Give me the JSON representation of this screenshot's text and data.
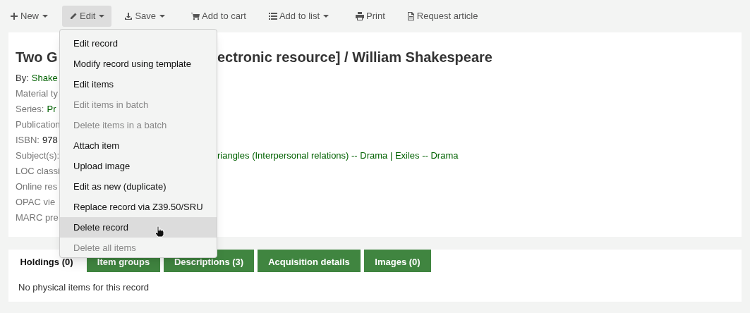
{
  "toolbar": [
    {
      "label": "New",
      "caret": true,
      "active": false
    },
    {
      "label": "Edit",
      "caret": true,
      "active": true
    },
    {
      "label": "Save",
      "caret": true,
      "active": false
    },
    {
      "label": "Add to cart",
      "caret": false,
      "active": false
    },
    {
      "label": "Add to list",
      "caret": true,
      "active": false
    },
    {
      "label": "Print",
      "caret": false,
      "active": false
    },
    {
      "label": "Request article",
      "caret": false,
      "active": false
    }
  ],
  "edit_menu": [
    {
      "label": "Edit record",
      "disabled": false,
      "highlighted": false
    },
    {
      "label": "Modify record using template",
      "disabled": false,
      "highlighted": false
    },
    {
      "label": "Edit items",
      "disabled": false,
      "highlighted": false
    },
    {
      "label": "Edit items in batch",
      "disabled": true,
      "highlighted": false
    },
    {
      "label": "Delete items in a batch",
      "disabled": true,
      "highlighted": false
    },
    {
      "label": "Attach item",
      "disabled": false,
      "highlighted": false
    },
    {
      "label": "Upload image",
      "disabled": false,
      "highlighted": false
    },
    {
      "label": "Edit as new (duplicate)",
      "disabled": false,
      "highlighted": false
    },
    {
      "label": "Replace record via Z39.50/SRU",
      "disabled": false,
      "highlighted": false
    },
    {
      "label": "Delete record",
      "disabled": false,
      "highlighted": true
    },
    {
      "label": "Delete all items",
      "disabled": true,
      "highlighted": false
    }
  ],
  "record": {
    "title_start": "Two G",
    "title_end": "ectronic resource] / William Shakespeare",
    "fields": [
      {
        "label": "By:",
        "value": "Shake",
        "kind": "link"
      },
      {
        "label": "Material ty"
      },
      {
        "label": "Series:",
        "value": "Pr",
        "kind": "link"
      },
      {
        "label": "Publication"
      },
      {
        "label": "ISBN:",
        "value": "978",
        "kind": "text"
      },
      {
        "label": "Subject(s):",
        "rest": "riangles (Interpersonal relations) -- Drama | Exiles -- Drama"
      },
      {
        "label": "LOC classi"
      },
      {
        "label": "Online res"
      },
      {
        "label": "OPAC vie"
      },
      {
        "label": "MARC pre"
      }
    ]
  },
  "tabs": [
    {
      "label": "Holdings (0)",
      "selected": true
    },
    {
      "label": "Item groups",
      "selected": false
    },
    {
      "label": "Descriptions (3)",
      "selected": false
    },
    {
      "label": "Acquisition details",
      "selected": false
    },
    {
      "label": "Images (0)",
      "selected": false
    }
  ],
  "tab_content": "No physical items for this record"
}
